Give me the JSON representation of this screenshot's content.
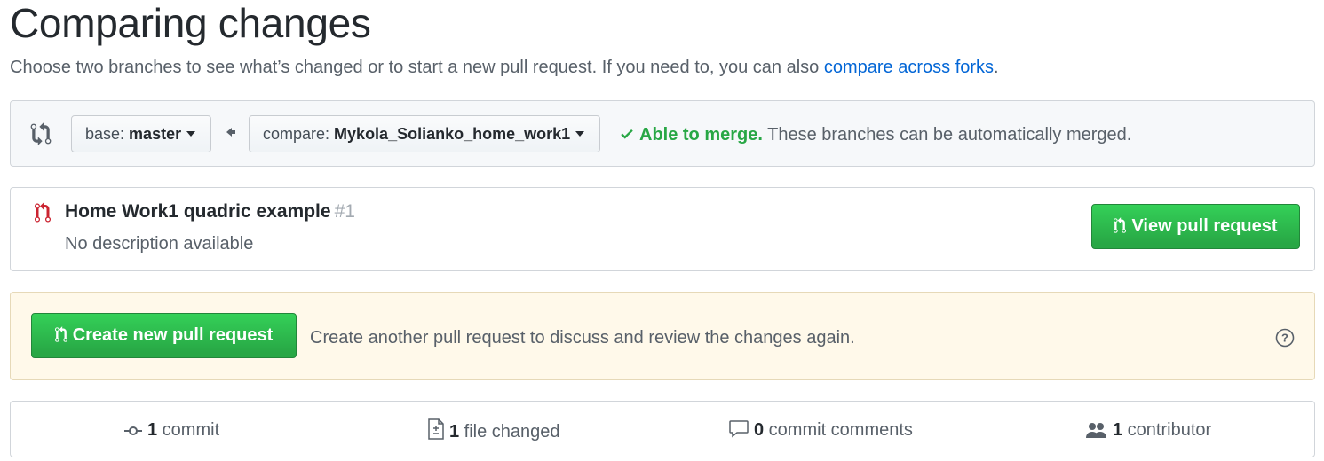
{
  "header": {
    "title": "Comparing changes",
    "subtitle_prefix": "Choose two branches to see what’s changed or to start a new pull request. If you need to, you can also ",
    "subtitle_link": "compare across forks",
    "subtitle_suffix": "."
  },
  "range": {
    "icon": "git-compare-icon",
    "base_prefix": "base: ",
    "base_branch": "master",
    "arrow_icon": "arrow-left-icon",
    "compare_prefix": "compare: ",
    "compare_branch": "Mykola_Solianko_home_work1",
    "merge_ok": "Able to merge.",
    "merge_text": " These branches can be automatically merged."
  },
  "existing_pr": {
    "icon": "git-pull-request-icon",
    "title": "Home Work1 quadric example",
    "number": "#1",
    "description": "No description available",
    "view_button": "View pull request"
  },
  "create": {
    "button": "Create new pull request",
    "text": "Create another pull request to discuss and review the changes again.",
    "help_icon": "question-icon"
  },
  "stats": {
    "commits_count": "1",
    "commits_label": " commit",
    "files_count": "1",
    "files_label": " file changed",
    "comments_count": "0",
    "comments_label": " commit comments",
    "contributors_count": "1",
    "contributors_label": " contributor"
  },
  "colors": {
    "link": "#0366d6",
    "success": "#28a745",
    "pr_open_icon": "#cb2431",
    "notice_bg": "#fff9ea"
  }
}
